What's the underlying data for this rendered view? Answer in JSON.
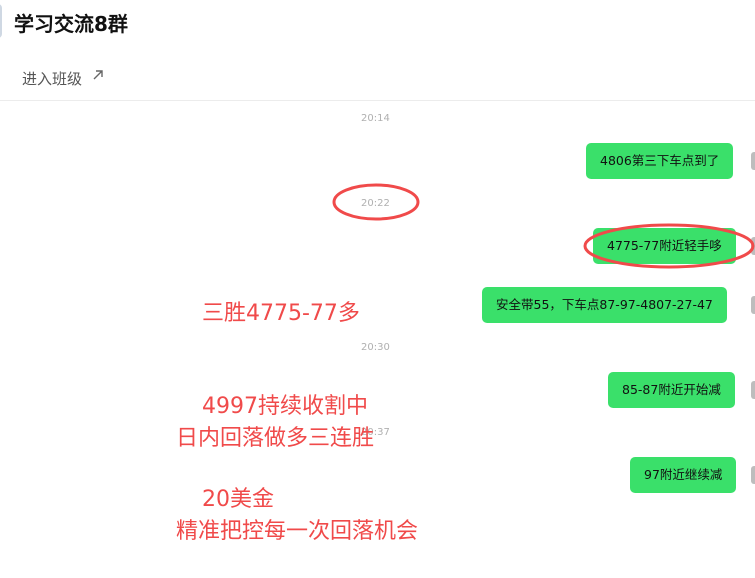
{
  "header": {
    "title": "学习交流8群",
    "enter_class": "进入班级"
  },
  "timestamps": [
    "20:14",
    "20:22",
    "20:30",
    "20:37"
  ],
  "messages": [
    "4806第三下车点到了",
    "4775-77附近轻手哆",
    "安全带55，下车点87-97-4807-27-47",
    "85-87附近开始减",
    "97附近继续减"
  ],
  "overlay": {
    "block1": [
      "三胜4775-77多",
      "4997持续收割中",
      "20美金"
    ],
    "block2": [
      "日内回落做多三连胜",
      "精准把控每一次回落机会"
    ]
  },
  "colors": {
    "bubble": "#3ae06a",
    "annotation": "#f04a4a"
  }
}
